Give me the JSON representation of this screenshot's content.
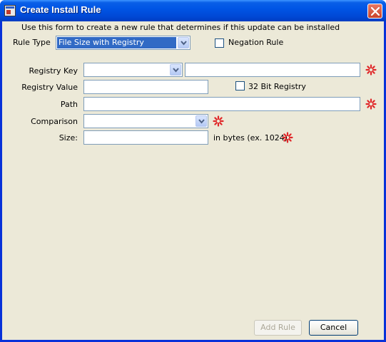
{
  "window": {
    "title": "Create Install Rule"
  },
  "form": {
    "instruction": "Use this form to create a new rule that determines if this update can be installed",
    "rule_type_label": "Rule Type",
    "rule_type_value": "File Size with Registry",
    "negation_label": "Negation Rule",
    "negation_checked": false,
    "registry_key_label": "Registry Key",
    "registry_key_value": "",
    "registry_subkey_value": "",
    "registry_value_label": "Registry Value",
    "registry_value_value": "",
    "bit32_label": "32 Bit Registry",
    "bit32_checked": false,
    "path_label": "Path",
    "path_value": "",
    "comparison_label": "Comparison",
    "comparison_value": "",
    "size_label": "Size:",
    "size_value": "",
    "size_hint": "in bytes (ex. 1024)"
  },
  "buttons": {
    "add_rule": "Add Rule",
    "add_rule_enabled": false,
    "cancel": "Cancel"
  },
  "colors": {
    "titlebar": "#0055e5",
    "dialog_bg": "#ece9d8",
    "selection": "#316ac5",
    "required_marker": "#e0282a",
    "field_border": "#7f9db9"
  },
  "icons": {
    "window_icon": "application-icon",
    "close": "close-icon",
    "dropdown": "chevron-down-icon",
    "required": "required-field-icon"
  }
}
